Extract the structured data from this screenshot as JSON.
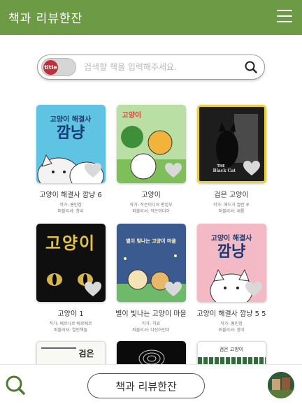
{
  "app": {
    "title": "책과 리뷰한잔"
  },
  "search": {
    "toggle_label": "title",
    "placeholder": "검색할 책을 입력해주세요.",
    "value": ""
  },
  "books": [
    {
      "title": "고양이 해결사 깜냥 6",
      "author": "작가: 홍민정",
      "publisher": "퍼블리셔: 창비",
      "cover_text_top": "고양이 해결사",
      "cover_text_main": "깜냥"
    },
    {
      "title": "고양이",
      "author": "작가: 작은미디어 편집부",
      "publisher": "퍼블리셔: 작은미디어",
      "cover_text_top": "고양이",
      "cover_text_main": ""
    },
    {
      "title": "검은 고양이",
      "author": "작가: 에드거 앨런 포",
      "publisher": "퍼블리셔: 새롬",
      "cover_text_top": "THE",
      "cover_text_main": "Black Cat"
    },
    {
      "title": "고양이 1",
      "author": "작가: 베르나르 베르베르",
      "publisher": "퍼블리셔: 열린책들",
      "cover_text_top": "고양이",
      "cover_text_main": ""
    },
    {
      "title": "별이 빛나는 고양이 마을",
      "author": "작가: 히료",
      "publisher": "퍼블리셔: 다산어린이",
      "cover_text_top": "별이 빛나는 고양이 마을",
      "cover_text_main": ""
    },
    {
      "title": "고양이 해결사 깜냥 5 5",
      "author": "작가: 홍민정",
      "publisher": "퍼블리셔: 창비",
      "cover_text_top": "고양이 해결사",
      "cover_text_main": "깜냥"
    },
    {
      "title": "",
      "author": "",
      "publisher": "",
      "cover_text_top": "검은",
      "cover_text_main": ""
    },
    {
      "title": "",
      "author": "",
      "publisher": "",
      "cover_text_top": "",
      "cover_text_main": ""
    },
    {
      "title": "",
      "author": "",
      "publisher": "",
      "cover_text_top": "검은 고양이",
      "cover_text_main": ""
    }
  ],
  "bottom": {
    "button_label": "책과 리뷰한잔"
  },
  "colors": {
    "brand": "#6c9a45",
    "toggle_knob": "#c0303a",
    "heart": "#d9d9d9"
  },
  "icons": [
    "menu-icon",
    "search-icon",
    "heart-icon",
    "avatar"
  ]
}
